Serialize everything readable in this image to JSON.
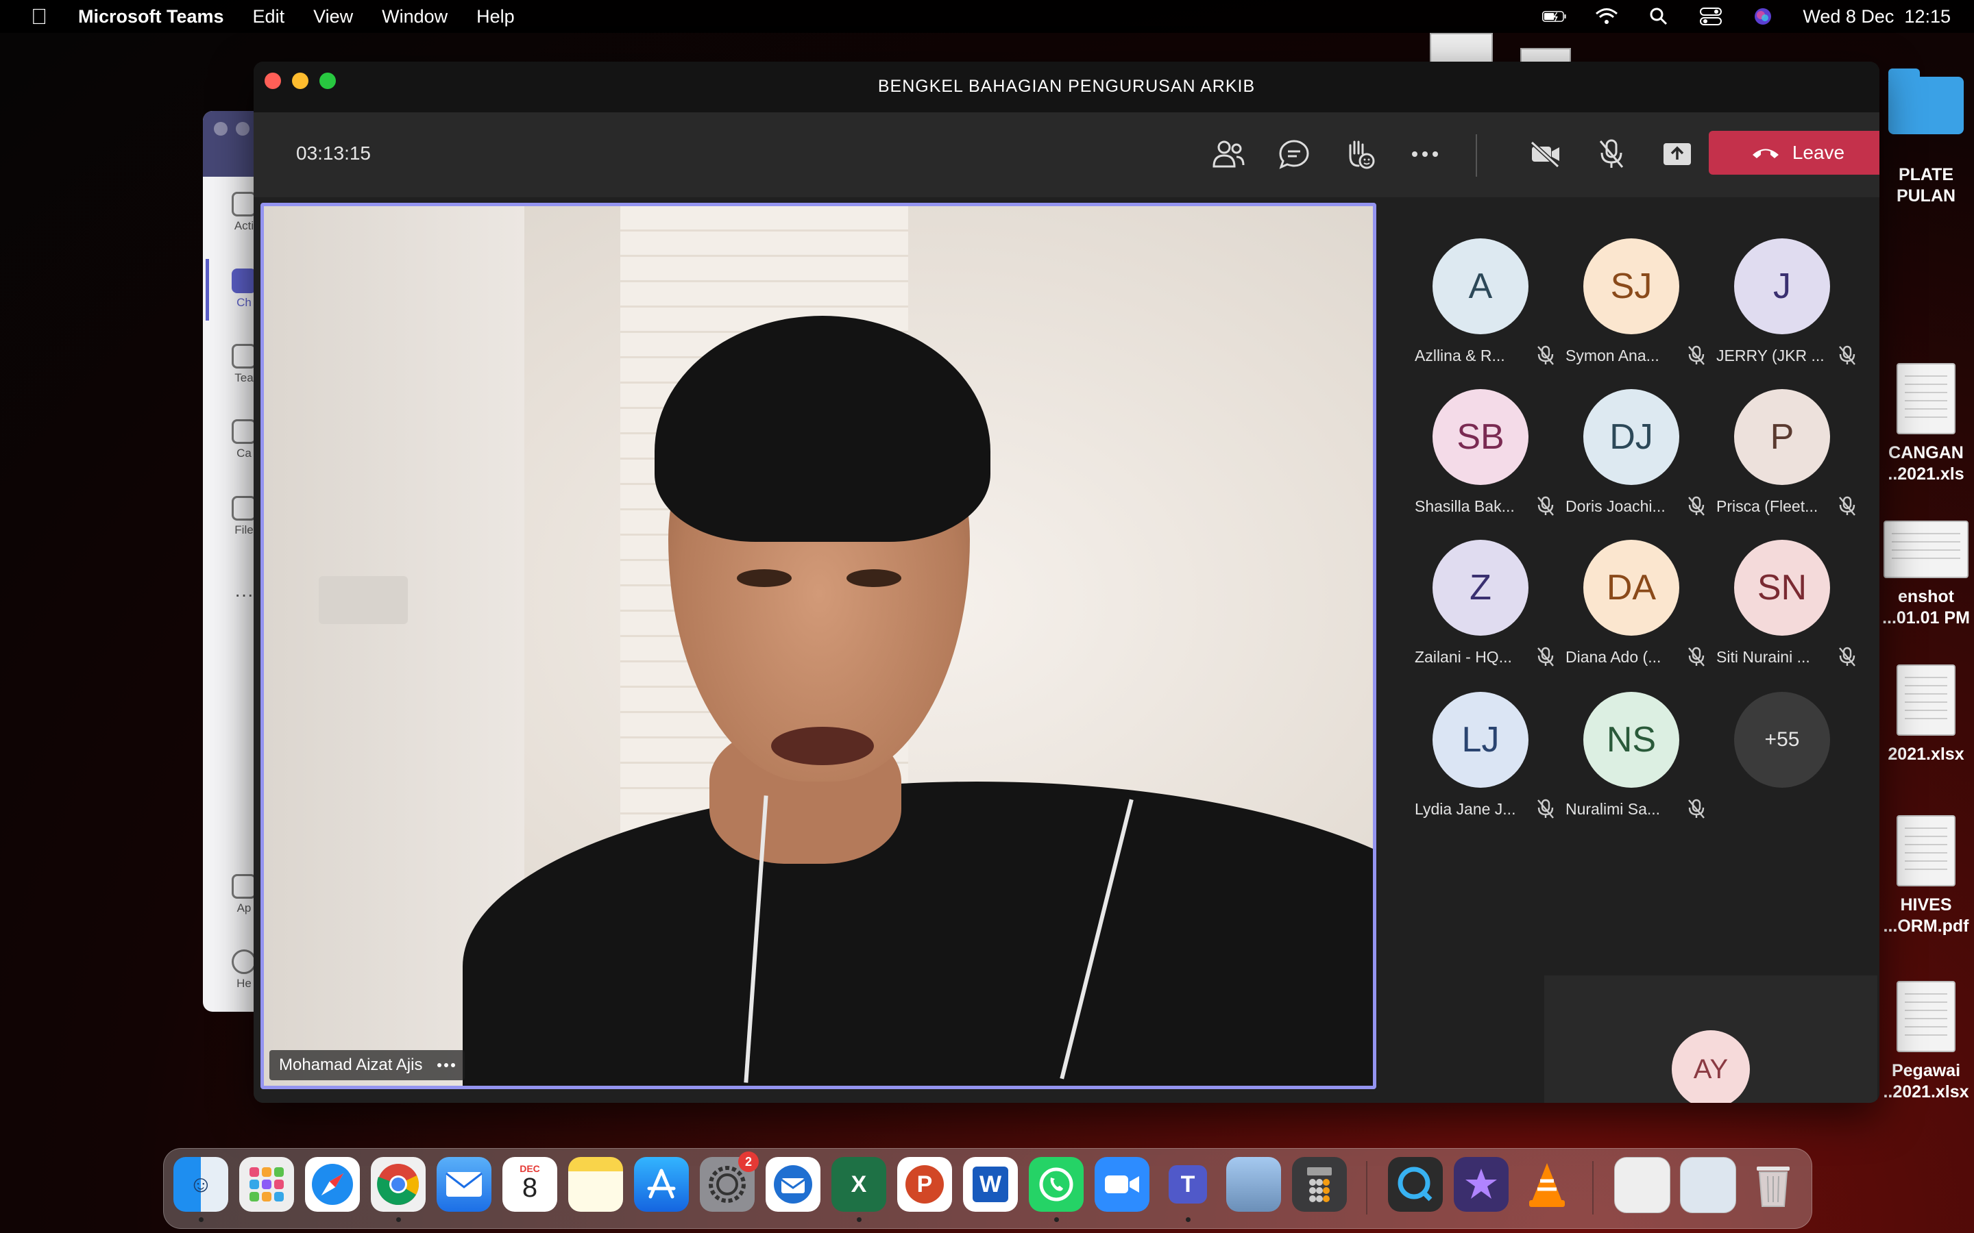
{
  "menubar": {
    "app_name": "Microsoft Teams",
    "menus": [
      "Edit",
      "View",
      "Window",
      "Help"
    ],
    "datetime": "Wed 8 Dec  12:15"
  },
  "desktop": {
    "items": [
      {
        "label_1": "PLATE",
        "label_2": "PULAN"
      },
      {
        "label_1": "CANGAN",
        "label_2": "..2021.xls"
      },
      {
        "label_1": "enshot",
        "label_2": "...01.01 PM"
      },
      {
        "label_1": "",
        "label_2": "2021.xlsx"
      },
      {
        "label_1": "HIVES",
        "label_2": "...ORM.pdf"
      },
      {
        "label_1": "Pegawai",
        "label_2": "..2021.xlsx"
      }
    ]
  },
  "bg_window": {
    "rail": [
      "Acti",
      "Ch",
      "Tea",
      "Ca",
      "File",
      "Ap",
      "He"
    ]
  },
  "meeting": {
    "title": "BENGKEL BAHAGIAN PENGURUSAN ARKIB",
    "timer": "03:13:15",
    "leave_label": "Leave",
    "speaker_name": "Mohamad Aizat Ajis",
    "participants": [
      {
        "initials": "A",
        "name": "Azllina & R...",
        "bg": "#dde9f1",
        "fg": "#2c4858"
      },
      {
        "initials": "SJ",
        "name": "Symon Ana...",
        "bg": "#fbe6cf",
        "fg": "#8a4a1a"
      },
      {
        "initials": "J",
        "name": "JERRY (JKR ...",
        "bg": "#e0dcf0",
        "fg": "#3a3070"
      },
      {
        "initials": "SB",
        "name": "Shasilla Bak...",
        "bg": "#f4dbe8",
        "fg": "#7a2a52"
      },
      {
        "initials": "DJ",
        "name": "Doris Joachi...",
        "bg": "#dde9f1",
        "fg": "#2c4858"
      },
      {
        "initials": "P",
        "name": "Prisca (Fleet...",
        "bg": "#ede1dc",
        "fg": "#5a3a30"
      },
      {
        "initials": "Z",
        "name": "Zailani - HQ...",
        "bg": "#e0dcf0",
        "fg": "#3a3070"
      },
      {
        "initials": "DA",
        "name": "Diana Ado (...",
        "bg": "#fbe6cf",
        "fg": "#8a4a1a"
      },
      {
        "initials": "SN",
        "name": "Siti Nuraini ...",
        "bg": "#f4dada",
        "fg": "#7a2a32"
      },
      {
        "initials": "LJ",
        "name": "Lydia Jane J...",
        "bg": "#dbe5f4",
        "fg": "#2a4470"
      },
      {
        "initials": "NS",
        "name": "Nuralimi Sa...",
        "bg": "#dcefe2",
        "fg": "#2a5a3a"
      }
    ],
    "more_count": "+55",
    "self_initials": "AY"
  },
  "dock": {
    "calendar_month": "DEC",
    "calendar_day": "8",
    "settings_badge": "2"
  },
  "colors": {
    "leave": "#c4314b",
    "active_speaker_border": "#9494f0",
    "toolbar": "#292929"
  }
}
